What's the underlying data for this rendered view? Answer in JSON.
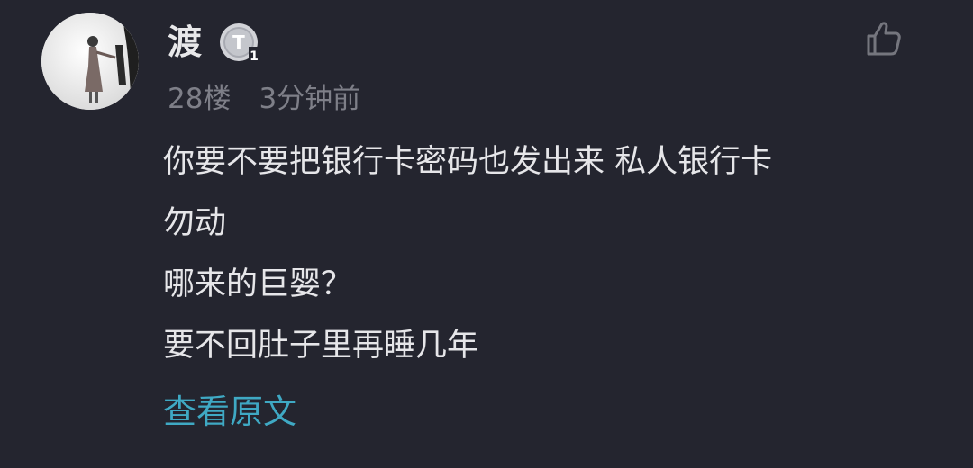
{
  "comment": {
    "username": "渡",
    "badge": {
      "letter": "T",
      "level": "1"
    },
    "floor": "28楼",
    "time": "3分钟前",
    "lines": [
      "你要不要把银行卡密码也发出来 私人银行卡",
      "勿动",
      "哪来的巨婴？",
      "要不回肚子里再睡几年"
    ],
    "view_original": "查看原文"
  },
  "icons": {
    "like": "thumbs-up-icon",
    "badge": "level-badge-icon"
  },
  "colors": {
    "background": "#24252f",
    "text": "#e6e6e9",
    "meta": "#7e7f88",
    "link": "#3fa9c4"
  }
}
